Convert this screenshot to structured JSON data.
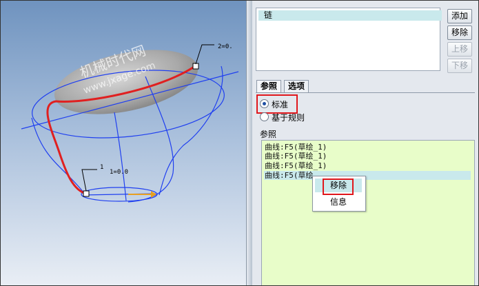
{
  "viewport": {
    "watermark_cn": "机械时代网",
    "watermark_url": "www.jxage.com",
    "dim_top": "2=0.",
    "dim_bottom": "1=0.0",
    "dim_bottom_marker": "1"
  },
  "chain": {
    "items": [
      "链"
    ]
  },
  "buttons": {
    "add": "添加",
    "remove": "移除",
    "move_up": "上移",
    "move_down": "下移"
  },
  "tabs": {
    "reference": "参照",
    "options": "选项"
  },
  "radio": {
    "standard": "标准",
    "rule_based": "基于规则"
  },
  "references": {
    "label": "参照",
    "items": [
      "曲线:F5(草绘_1)",
      "曲线:F5(草绘_1)",
      "曲线:F5(草绘_1)",
      "曲线:F5(草绘"
    ]
  },
  "context_menu": {
    "remove": "移除",
    "info": "信息"
  },
  "colors": {
    "highlight_red": "#e0161b",
    "selection": "#c9e9ec",
    "list_bg": "#e8fdc9",
    "curve_blue": "#1f3ff0",
    "chain_red": "#e02020"
  }
}
